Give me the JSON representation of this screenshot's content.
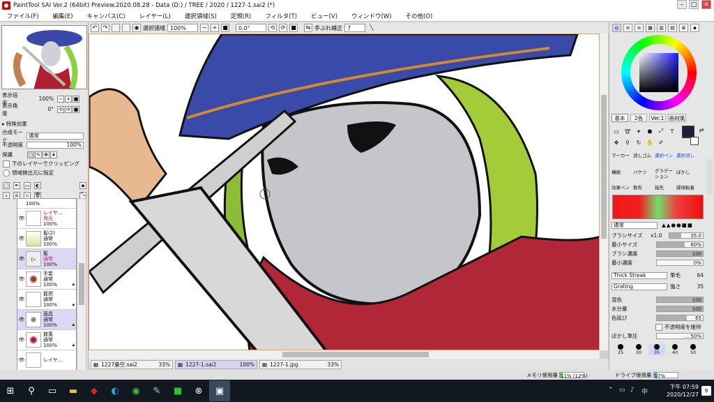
{
  "window": {
    "title": "PaintTool SAI Ver.2 (64bit) Preview.2020.08.28 - Data (D:) / TREE / 2020 / 1227-1.sai2 (*)"
  },
  "menu": [
    "ファイル(F)",
    "編集(E)",
    "キャンバス(C)",
    "レイヤー(L)",
    "選択領域(S)",
    "定規(R)",
    "フィルタ(T)",
    "ビュー(V)",
    "ウィンドウ(W)",
    "その他(O)"
  ],
  "toolbar": {
    "selection_label": "選択領域",
    "zoom": "100%",
    "rotation": "0.0°",
    "stabilizer_label": "手ぶれ補正",
    "stabilizer_value": "7"
  },
  "left": {
    "zoom_label": "表示倍率",
    "zoom_value": "100%",
    "angle_label": "表示角度",
    "angle_value": "0°",
    "effects_label": "特殊効果",
    "blend_label": "合成モード",
    "blend_value": "通常",
    "opacity_label": "不透明度",
    "opacity_value": "100%",
    "protect_label": "保護",
    "clip_label": "下のレイヤーでクリッピング",
    "selection_source_label": "領域検出元に指定"
  },
  "layers": [
    {
      "name": "",
      "mode": "100%",
      "opacity": ""
    },
    {
      "name": "レイヤ...",
      "mode": "発光",
      "opacity": "100%"
    },
    {
      "name": "髪(2)",
      "mode": "通常",
      "opacity": "100%"
    },
    {
      "name": "髪",
      "mode": "通常",
      "opacity": "100%"
    },
    {
      "name": "手套",
      "mode": "通常",
      "opacity": "100%"
    },
    {
      "name": "握把",
      "mode": "通常",
      "opacity": "100%"
    },
    {
      "name": "面具",
      "mode": "通常",
      "opacity": "100%"
    },
    {
      "name": "披風",
      "mode": "通常",
      "opacity": "100%"
    },
    {
      "name": "レイヤ...",
      "mode": "",
      "opacity": ""
    }
  ],
  "doc_tabs": [
    {
      "name": "1227量空.sai2",
      "zoom": "33%"
    },
    {
      "name": "1227-1.sai2",
      "zoom": "100%"
    },
    {
      "name": "1227-1.jpg",
      "zoom": "33%"
    }
  ],
  "status": {
    "memory_label": "メモリ使用量",
    "memory_value": "11% (12%)",
    "memory_fraction": 0.11,
    "drive_label": "ドライブ使用量",
    "drive_value": "17%",
    "drive_fraction": 0.17
  },
  "right": {
    "color_set_tabs": [
      "基本",
      "2色",
      "Ver.1",
      "画材風"
    ],
    "brush_tools": [
      "マーカー",
      "消しゴム",
      "選択ペン",
      "選択消し",
      "構線",
      "バケツ",
      "グラデーション",
      "ぼかし",
      "効果ペン",
      "散布",
      "指先",
      "縁境転着"
    ],
    "blend_mode": "通常",
    "brush_size_label": "ブラシサイズ",
    "brush_size_mult": "x1.0",
    "brush_size_value": "35.0",
    "min_size_label": "最小サイズ",
    "min_size_value": "60%",
    "min_size_fraction": 0.6,
    "density_label": "ブラシ濃度",
    "density_value": "100",
    "density_fraction": 1.0,
    "min_density_label": "最小濃度",
    "min_density_value": "0%",
    "min_density_fraction": 0.0,
    "texture_name": "Thick Streak",
    "texture_param_label": "筆毛",
    "texture_param_value": "64",
    "shape_name": "Grating",
    "shape_param_label": "強さ",
    "shape_param_value": "35",
    "mixing_label": "混色",
    "mixing_value": "100",
    "mixing_fraction": 1.0,
    "water_label": "水分量",
    "water_value": "100",
    "water_fraction": 1.0,
    "persistence_label": "色延び",
    "persistence_value": "65",
    "persistence_fraction": 0.65,
    "keep_opacity_label": "不透明度を維持",
    "blur_pressure_label": "ぼかし筆圧",
    "blur_pressure_value": "... 50%",
    "brush_sizes": [
      "25",
      "30",
      "35",
      "40",
      "50"
    ]
  },
  "taskbar": {
    "time": "下午 07:59",
    "date": "2020/12/27",
    "notification_count": "9"
  }
}
